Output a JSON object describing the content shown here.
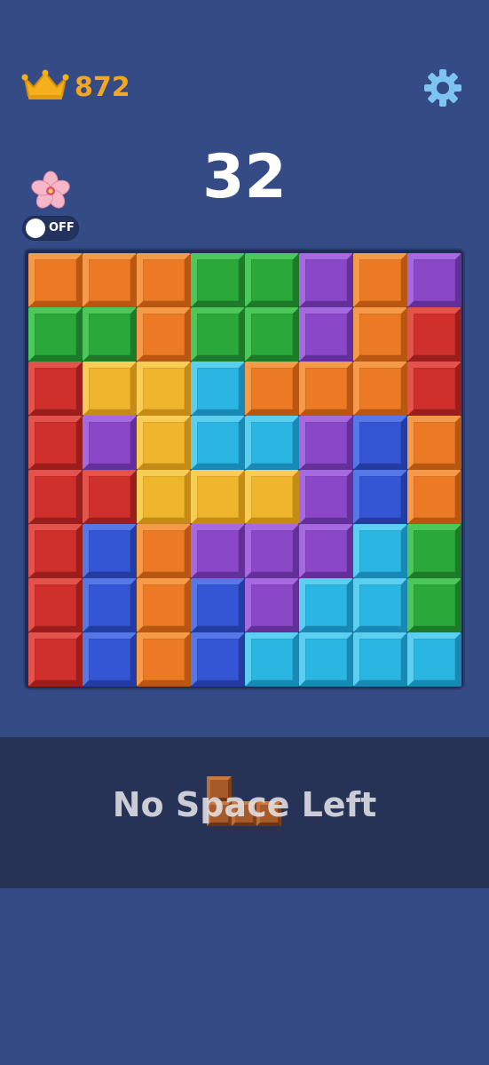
{
  "best_score": "872",
  "score": "32",
  "toggle_label": "OFF",
  "banner_text": "No Space Left",
  "icons": {
    "best": "crown-icon",
    "settings": "gear-icon",
    "mode": "cherry-blossom-icon"
  },
  "colors": {
    "background": "#354b86",
    "best_score": "#f5a623",
    "settings_icon": "#7ec4f2"
  },
  "palette": {
    "O": {
      "base": "#ec7a24",
      "light": "#f59a48",
      "dark": "#b85612"
    },
    "G": {
      "base": "#2aa83a",
      "light": "#4cc75a",
      "dark": "#1c7a28"
    },
    "P": {
      "base": "#8a48c8",
      "light": "#a56ae0",
      "dark": "#63309a"
    },
    "R": {
      "base": "#d0302c",
      "light": "#e4524c",
      "dark": "#9c1e1c"
    },
    "Y": {
      "base": "#efb52c",
      "light": "#f7cd55",
      "dark": "#c48c14"
    },
    "C": {
      "base": "#2ab6e2",
      "light": "#5ccef0",
      "dark": "#1a88b4"
    },
    "B": {
      "base": "#3455d4",
      "light": "#5678e6",
      "dark": "#233ca2"
    }
  },
  "grid": [
    [
      "O",
      "O",
      "O",
      "G",
      "G",
      "P",
      "O",
      "P"
    ],
    [
      "G",
      "G",
      "O",
      "G",
      "G",
      "P",
      "O",
      "R"
    ],
    [
      "R",
      "Y",
      "Y",
      "C",
      "O",
      "O",
      "O",
      "R"
    ],
    [
      "R",
      "P",
      "Y",
      "C",
      "C",
      "P",
      "B",
      "O"
    ],
    [
      "R",
      "R",
      "Y",
      "Y",
      "Y",
      "P",
      "B",
      "O"
    ],
    [
      "R",
      "B",
      "O",
      "P",
      "P",
      "P",
      "C",
      "G"
    ],
    [
      "R",
      "B",
      "O",
      "B",
      "P",
      "C",
      "C",
      "G"
    ],
    [
      "R",
      "B",
      "O",
      "B",
      "C",
      "C",
      "C",
      "C"
    ]
  ],
  "next_piece": {
    "color": "#a65a2a",
    "shape": [
      [
        1,
        0,
        0
      ],
      [
        1,
        1,
        1
      ]
    ]
  }
}
